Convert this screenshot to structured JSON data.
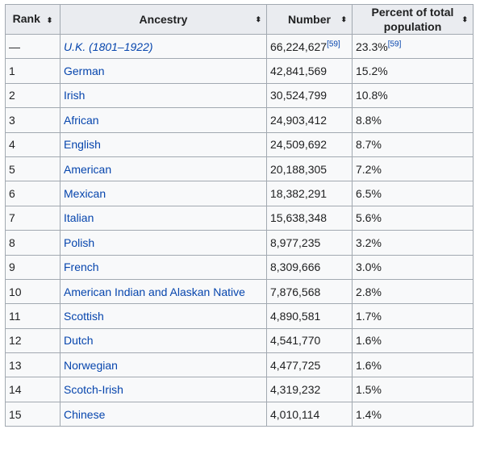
{
  "headers": {
    "rank": "Rank",
    "ancestry": "Ancestry",
    "number": "Number",
    "percent_line1": "Percent of total",
    "percent_line2": "population",
    "sort_glyph": "⬍"
  },
  "rows": [
    {
      "rank": "—",
      "ancestry": "U.K. (1801–1922)",
      "number": "66,224,627",
      "number_ref": "[59]",
      "percent": "23.3%",
      "percent_ref": "[59]"
    },
    {
      "rank": "1",
      "ancestry": "German",
      "number": "42,841,569",
      "percent": "15.2%"
    },
    {
      "rank": "2",
      "ancestry": "Irish",
      "number": "30,524,799",
      "percent": "10.8%"
    },
    {
      "rank": "3",
      "ancestry": "African",
      "number": "24,903,412",
      "percent": "8.8%"
    },
    {
      "rank": "4",
      "ancestry": "English",
      "number": "24,509,692",
      "percent": "8.7%"
    },
    {
      "rank": "5",
      "ancestry": "American",
      "number": "20,188,305",
      "percent": "7.2%"
    },
    {
      "rank": "6",
      "ancestry": "Mexican",
      "number": "18,382,291",
      "percent": "6.5%"
    },
    {
      "rank": "7",
      "ancestry": "Italian",
      "number": "15,638,348",
      "percent": "5.6%"
    },
    {
      "rank": "8",
      "ancestry": "Polish",
      "number": "8,977,235",
      "percent": "3.2%"
    },
    {
      "rank": "9",
      "ancestry": "French",
      "number": "8,309,666",
      "percent": "3.0%"
    },
    {
      "rank": "10",
      "ancestry": "American Indian and Alaskan Native",
      "number": "7,876,568",
      "percent": "2.8%"
    },
    {
      "rank": "11",
      "ancestry": "Scottish",
      "number": "4,890,581",
      "percent": "1.7%"
    },
    {
      "rank": "12",
      "ancestry": "Dutch",
      "number": "4,541,770",
      "percent": "1.6%"
    },
    {
      "rank": "13",
      "ancestry": "Norwegian",
      "number": "4,477,725",
      "percent": "1.6%"
    },
    {
      "rank": "14",
      "ancestry": "Scotch-Irish",
      "number": "4,319,232",
      "percent": "1.5%"
    },
    {
      "rank": "15",
      "ancestry": "Chinese",
      "number": "4,010,114",
      "percent": "1.4%"
    }
  ]
}
